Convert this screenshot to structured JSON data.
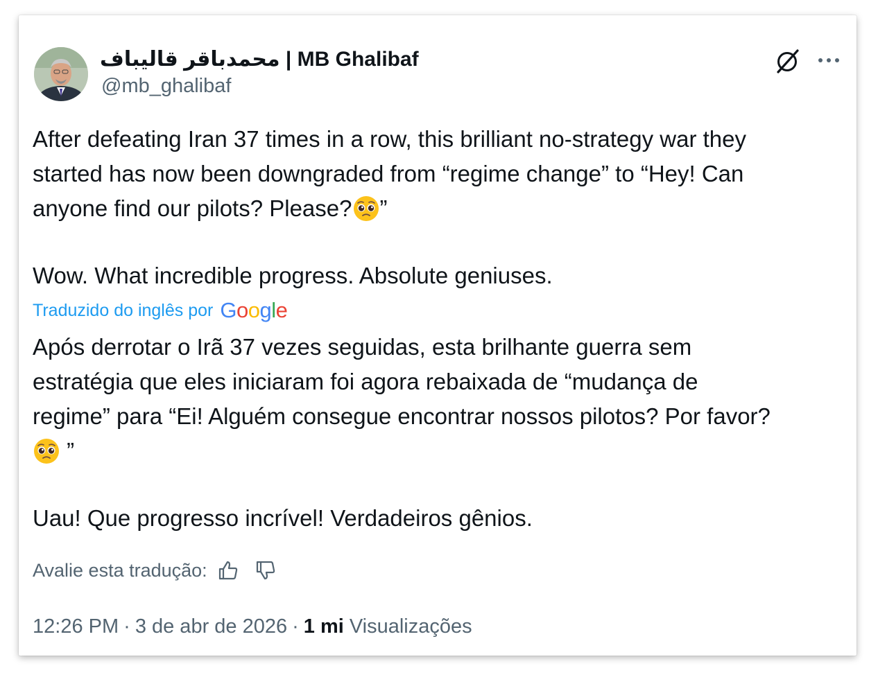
{
  "author": {
    "display_name": "محمدباقر قالیباف | MB Ghalibaf",
    "handle": "@mb_ghalibaf"
  },
  "icons": {
    "avatar": "profile-photo",
    "grok": "grok-icon",
    "more": "more-options-icon",
    "emoji": "pleading-face-emoji",
    "thumbs_up": "thumbs-up-icon",
    "thumbs_down": "thumbs-down-icon"
  },
  "tweet": {
    "original_line1": "After defeating Iran 37 times in a row, this brilliant no-strategy war they",
    "original_line2": "started has now been downgraded from “regime change” to “Hey! Can",
    "original_line3_before_emoji": "anyone find our pilots? Please?",
    "original_line3_after_emoji": "”",
    "original_line4": "Wow. What incredible progress. Absolute geniuses."
  },
  "translation": {
    "label": "Traduzido do inglês por",
    "provider": "Google",
    "line1": "Após derrotar o Irã 37 vezes seguidas, esta brilhante guerra sem",
    "line2": "estratégia que eles iniciaram foi agora rebaixada de “mudança de",
    "line3": "regime” para “Ei! Alguém consegue encontrar nossos pilotos? Por favor?",
    "line4_after_emoji": " ”",
    "line5": "Uau! Que progresso incrível! Verdadeiros gênios.",
    "rate_label": "Avalie esta tradução:"
  },
  "meta": {
    "time": "12:26 PM",
    "separator": "·",
    "date": "3 de abr de 2026",
    "views_count": "1 mi",
    "views_label": "Visualizações"
  },
  "colors": {
    "text_primary": "#0f1419",
    "text_secondary": "#536471",
    "link_blue": "#1d9bf0",
    "google_blue": "#4285f4",
    "google_red": "#ea4335",
    "google_yellow": "#fbbc05",
    "google_green": "#34a853"
  }
}
